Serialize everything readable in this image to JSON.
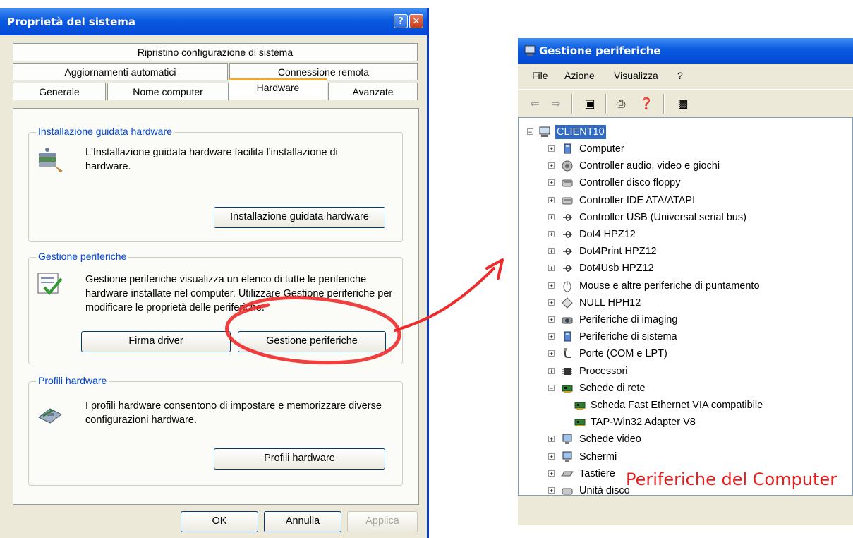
{
  "left_dialog": {
    "title": "Proprietà del sistema",
    "help_glyph": "?",
    "close_glyph": "✕",
    "tabs_row1": [
      "Ripristino configurazione di sistema"
    ],
    "tabs_row2": [
      "Aggiornamenti automatici",
      "Connessione remota"
    ],
    "tabs_row3": [
      "Generale",
      "Nome computer",
      "Hardware",
      "Avanzate"
    ],
    "active_tab": "Hardware",
    "groups": {
      "wizard": {
        "title": "Installazione guidata hardware",
        "text": "L'Installazione guidata hardware facilita l'installazione di hardware.",
        "button": "Installazione guidata hardware",
        "icon": "hardware-wizard-icon"
      },
      "devmgr": {
        "title": "Gestione periferiche",
        "text": "Gestione periferiche visualizza un elenco di tutte le periferiche hardware installate nel computer. Utilizzare Gestione periferiche per modificare le proprietà delle periferiche.",
        "button_driver": "Firma driver",
        "button_devmgr": "Gestione periferiche",
        "icon": "device-manager-icon"
      },
      "profiles": {
        "title": "Profili hardware",
        "text": "I profili hardware consentono di impostare e memorizzare diverse configurazioni hardware.",
        "button": "Profili hardware",
        "icon": "hardware-profiles-icon"
      }
    },
    "footer": {
      "ok": "OK",
      "cancel": "Annulla",
      "apply": "Applica"
    }
  },
  "device_manager": {
    "title": "Gestione periferiche",
    "menu": [
      "File",
      "Azione",
      "Visualizza",
      "?"
    ],
    "toolbar_icons": [
      "back-arrow-icon",
      "forward-arrow-icon",
      "properties-view-icon",
      "print-icon",
      "help-icon",
      "scan-hardware-icon"
    ],
    "root": "CLIENT10",
    "items": [
      {
        "label": "Computer",
        "icon": "computer-icon",
        "expanded": false
      },
      {
        "label": "Controller audio, video e giochi",
        "icon": "audio-icon",
        "expanded": false
      },
      {
        "label": "Controller disco floppy",
        "icon": "floppy-controller-icon",
        "expanded": false
      },
      {
        "label": "Controller IDE ATA/ATAPI",
        "icon": "ide-controller-icon",
        "expanded": false
      },
      {
        "label": "Controller USB (Universal serial bus)",
        "icon": "usb-icon",
        "expanded": false
      },
      {
        "label": "Dot4 HPZ12",
        "icon": "usb-icon",
        "expanded": false
      },
      {
        "label": "Dot4Print HPZ12",
        "icon": "usb-icon",
        "expanded": false
      },
      {
        "label": "Dot4Usb HPZ12",
        "icon": "usb-icon",
        "expanded": false
      },
      {
        "label": "Mouse e altre periferiche di puntamento",
        "icon": "mouse-icon",
        "expanded": false
      },
      {
        "label": "NULL HPH12",
        "icon": "diamond-icon",
        "expanded": false
      },
      {
        "label": "Periferiche di imaging",
        "icon": "camera-icon",
        "expanded": false
      },
      {
        "label": "Periferiche di sistema",
        "icon": "system-device-icon",
        "expanded": false
      },
      {
        "label": "Porte (COM e LPT)",
        "icon": "port-icon",
        "expanded": false
      },
      {
        "label": "Processori",
        "icon": "processor-icon",
        "expanded": false
      },
      {
        "label": "Schede di rete",
        "icon": "network-card-icon",
        "expanded": true
      },
      {
        "label": "Scheda Fast Ethernet VIA compatibile",
        "icon": "network-card-icon",
        "child": true
      },
      {
        "label": "TAP-Win32 Adapter V8",
        "icon": "network-card-icon",
        "child": true
      },
      {
        "label": "Schede video",
        "icon": "display-adapter-icon",
        "expanded": false
      },
      {
        "label": "Schermi",
        "icon": "monitor-icon",
        "expanded": false
      },
      {
        "label": "Tastiere",
        "icon": "keyboard-icon",
        "expanded": false
      },
      {
        "label": "Unità disco",
        "icon": "disk-drive-icon",
        "expanded": false
      }
    ]
  },
  "annotation": {
    "label": "Periferiche del Computer",
    "color": "#e81d1d"
  }
}
